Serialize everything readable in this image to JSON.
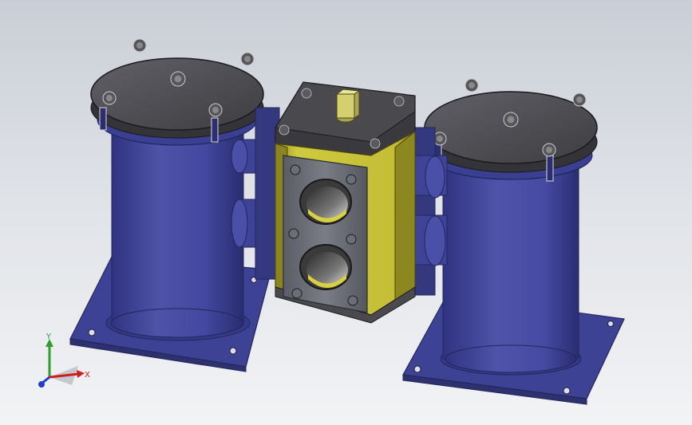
{
  "triad": {
    "x_label": "X",
    "y_label": "Y",
    "x_color": "#cc1f1f",
    "y_color": "#2e9e2e",
    "z_color": "#1f3fcc"
  },
  "model": {
    "filters": [
      {
        "name": "left-filter-housing",
        "lid_bolts": 5,
        "base_bolt_holes": 4
      },
      {
        "name": "right-filter-housing",
        "lid_bolts": 5,
        "base_bolt_holes": 4
      }
    ],
    "valve_block": {
      "window_ports": 2,
      "front_plate_bolts": 6
    },
    "colors": {
      "housing": "#4a4fa0",
      "lid": "#4a4a4e",
      "valve_body": "#c8c23a",
      "front_plate": "#6b6e78",
      "stem": "#d4d070"
    }
  },
  "background": {
    "top": "#c9ced6",
    "bottom": "#f2f3f5"
  }
}
